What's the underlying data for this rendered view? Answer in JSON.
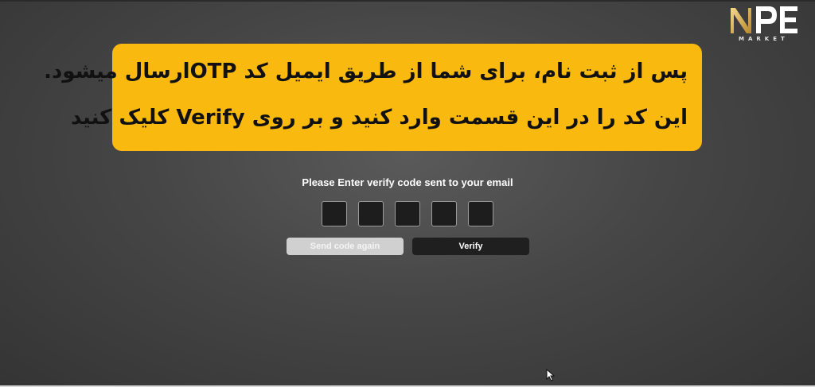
{
  "brand": {
    "logo_text": "MARKET",
    "logo_mark": "NPE"
  },
  "callout": {
    "line1": "پس از ثبت نام، برای شما از طریق ایمیل کد OTPارسال میشود.",
    "line2": "این کد را در این قسمت وارد کنید و بر روی Verify کلیک کنید",
    "background_color": "#f9b90f"
  },
  "verify_form": {
    "prompt": "Please Enter verify code sent to your email",
    "code_digits": [
      "",
      "",
      "",
      "",
      ""
    ],
    "resend_label": "Send code again",
    "verify_label": "Verify"
  },
  "icons": {
    "cursor": "mouse-pointer-icon"
  }
}
